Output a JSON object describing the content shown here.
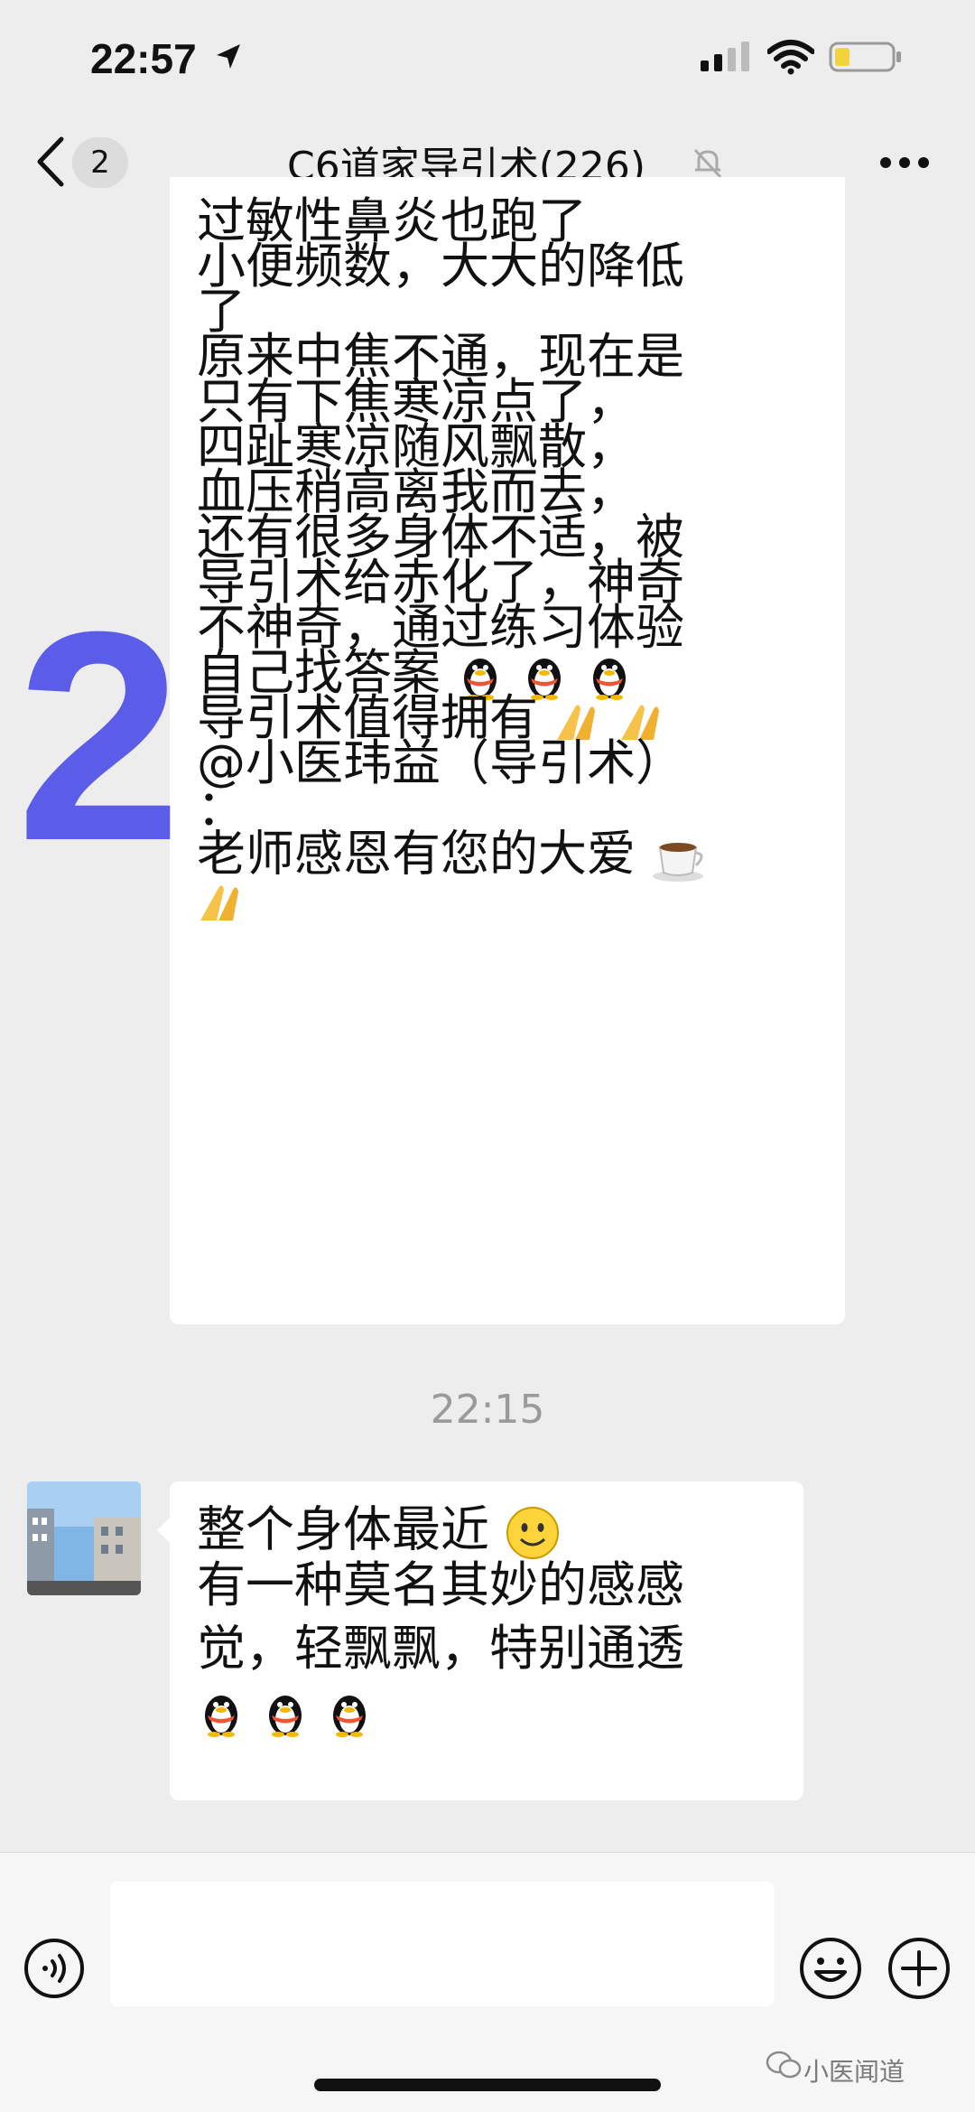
{
  "status_bar": {
    "time": "22:57"
  },
  "nav": {
    "unread_count": "2",
    "title": "C6道家导引术(226)"
  },
  "overlay_number": "2",
  "messages": [
    {
      "lines": [
        "过敏性鼻炎也跑了",
        "小便频数，大大的降低",
        "了",
        "原来中焦不通，现在是",
        "只有下焦寒凉点了，",
        "四趾寒凉随风飘散，",
        "血压稍高离我而去，",
        "还有很多身体不适，被",
        "导引术给赤化了，神奇",
        "不神奇，通过练习体验",
        "自己找答案",
        "导引术值得拥有",
        "@小医玮益（导引术）",
        "：",
        "老师感恩有您的大爱",
        ""
      ]
    },
    {
      "timestamp": "22:15",
      "lines": [
        " 整个身体最近",
        "有一种莫名其妙的感感",
        "觉，轻飘飘，特别通透",
        ""
      ]
    }
  ],
  "icons": {
    "emoji_penguin": "qq-penguin-emoji",
    "emoji_pray": "praying-hands-emoji",
    "emoji_coffee": "coffee-emoji",
    "emoji_smile": "smile-emoji"
  },
  "watermark": "小医闻道"
}
